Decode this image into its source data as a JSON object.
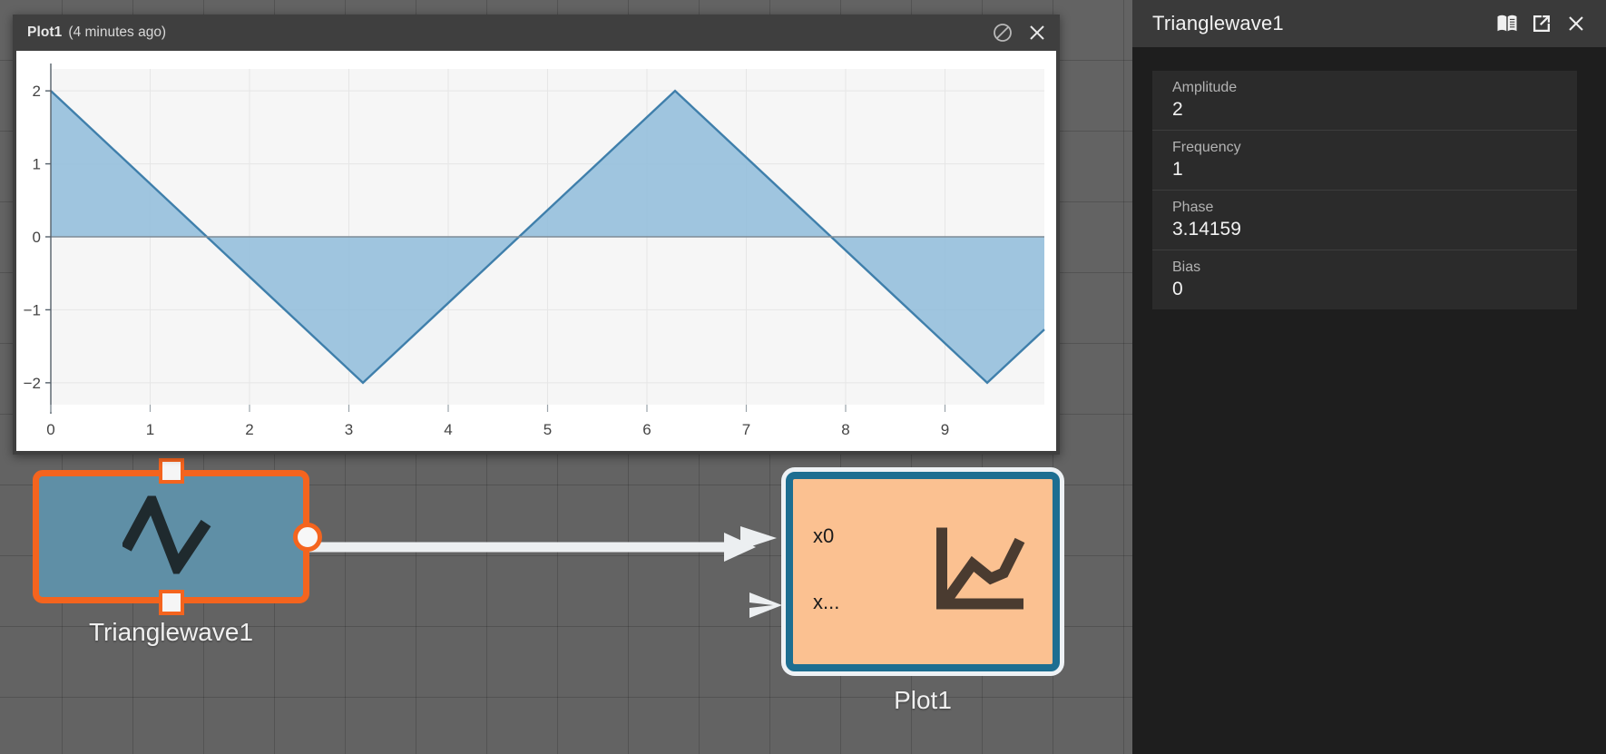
{
  "canvas": {
    "grid_color": "#636363"
  },
  "plot_window": {
    "title": "Plot1",
    "timestamp": "(4 minutes ago)",
    "buttons": [
      {
        "name": "block-icon",
        "label": "Disable updates"
      },
      {
        "name": "close-icon",
        "label": "Close"
      }
    ]
  },
  "chart_data": {
    "type": "area",
    "title": "Plot1",
    "xlabel": "",
    "ylabel": "",
    "xlim": [
      0,
      10
    ],
    "ylim": [
      -2.3,
      2.3
    ],
    "xticks": [
      "0",
      "1",
      "2",
      "3",
      "4",
      "5",
      "6",
      "7",
      "8",
      "9"
    ],
    "xtick_values": [
      0,
      1,
      2,
      3,
      4,
      5,
      6,
      7,
      8,
      9
    ],
    "yticks": [
      "2",
      "1",
      "0",
      "−1",
      "−2"
    ],
    "ytick_values": [
      2,
      1,
      0,
      -1,
      -2
    ],
    "grid": true,
    "legend": false,
    "series": [
      {
        "name": "Trianglewave1",
        "fill_color": "#8fbcdb",
        "line_color": "#3f7fab",
        "fill_opacity": 0.85,
        "x": [
          0,
          3.14159,
          6.28319,
          9.42478,
          10
        ],
        "y": [
          2,
          -2,
          2,
          -2,
          -1.27
        ]
      }
    ],
    "description": "Triangle wave, amplitude 2, frequency 1, phase 3.14159 (pi), bias 0; period 2*pi"
  },
  "nodes": [
    {
      "id": "trianglewave",
      "label": "Trianglewave1",
      "icon": "triangle-wave-icon",
      "fill": "#5f8fa6",
      "border": "#f4641e",
      "selected": true,
      "ports_out": [
        "out"
      ]
    },
    {
      "id": "plot",
      "label": "Plot1",
      "icon": "line-chart-icon",
      "fill": "#fbc191",
      "border": "#1d6e91",
      "selected": true,
      "ports_in": [
        "x0",
        "x..."
      ]
    }
  ],
  "link": {
    "from": "Trianglewave1",
    "to": "Plot1 x0",
    "color": "#eceff1"
  },
  "properties_panel": {
    "title": "Trianglewave1",
    "buttons": [
      {
        "name": "docs-icon",
        "label": "Documentation"
      },
      {
        "name": "popout-icon",
        "label": "Open in new window"
      },
      {
        "name": "close-icon",
        "label": "Close"
      }
    ],
    "rows": [
      {
        "label": "Amplitude",
        "value": "2"
      },
      {
        "label": "Frequency",
        "value": "1"
      },
      {
        "label": "Phase",
        "value": "3.14159"
      },
      {
        "label": "Bias",
        "value": "0"
      }
    ]
  }
}
